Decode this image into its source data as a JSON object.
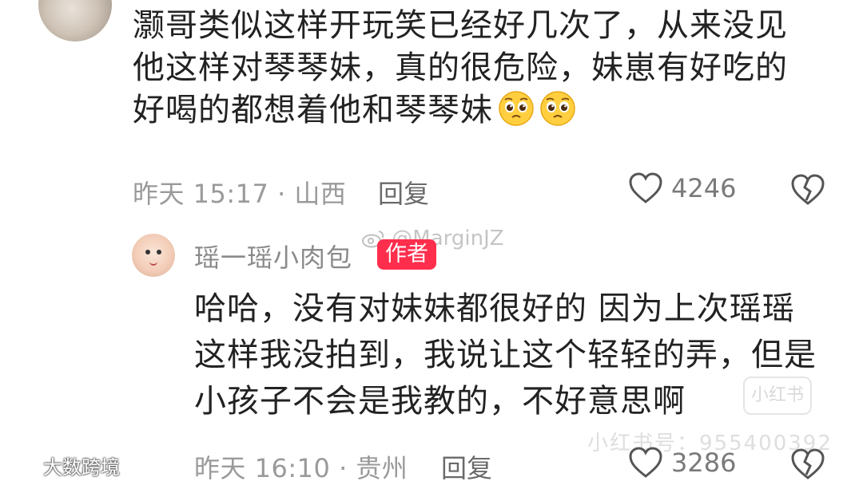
{
  "comment1": {
    "lines": [
      "灏哥类似这样开玩笑已经好几次了，从来没见",
      "他这样对琴琴妹，真的很危险，妹崽有好吃的",
      "好喝的都想着他和琴琴妹"
    ],
    "meta": "昨天 15:17 · 山西",
    "reply_label": "回复",
    "like_count": "4246"
  },
  "reply": {
    "username": "瑶一瑶小肉包",
    "badge": "作者",
    "lines": [
      "哈哈，没有对妹妹都很好的 因为上次瑶瑶",
      "这样我没拍到，我说让这个轻轻的弄，但是",
      "小孩子不会是我教的，不好意思啊"
    ],
    "meta": "昨天 16:10 · 贵州",
    "reply_label": "回复",
    "like_count": "3286"
  },
  "watermarks": {
    "weibo": "@MarginJZ",
    "xhs_box": "小红书",
    "xhs_id": "小红书号：955400392"
  },
  "corner_brand": "大数跨境",
  "colors": {
    "badge": "#ff2e4d",
    "meta": "#9a9a9a",
    "text": "#222222"
  }
}
